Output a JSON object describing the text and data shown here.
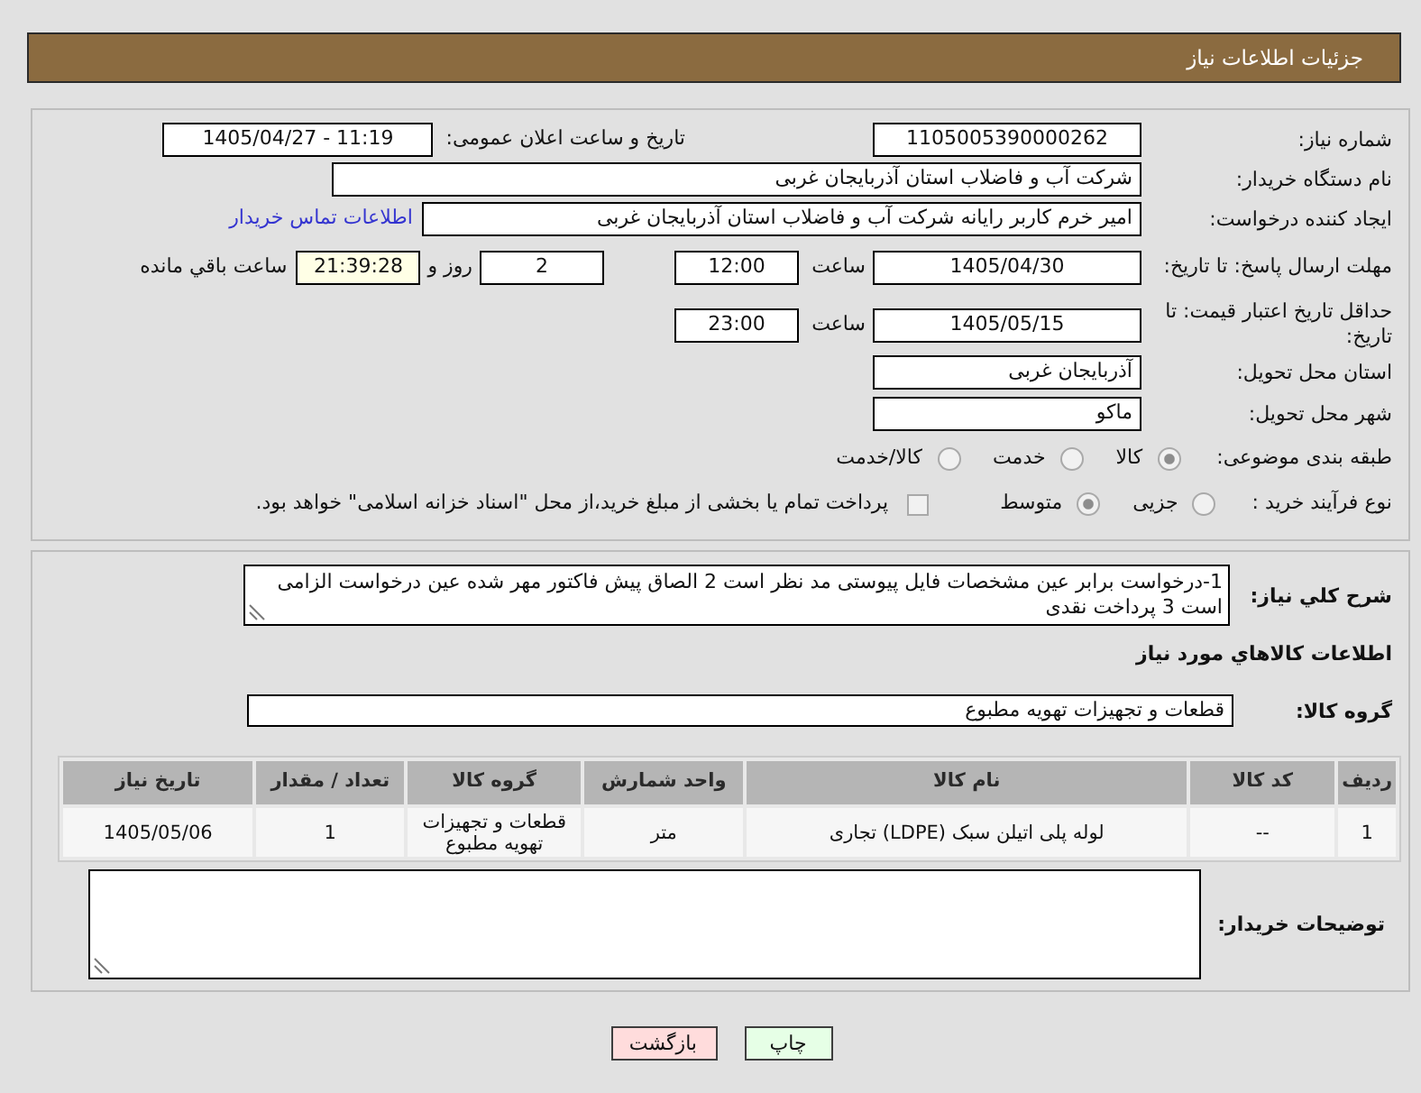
{
  "header": {
    "title": "جزئیات اطلاعات نیاز"
  },
  "need": {
    "number": {
      "label": "شماره نیاز:",
      "value": "1105005390000262"
    },
    "announce": {
      "label": "تاریخ و ساعت اعلان عمومی:",
      "value": "1405/04/27 - 11:19"
    },
    "buyer_org": {
      "label": "نام دستگاه خریدار:",
      "value": "شرکت آب و فاضلاب استان آذربایجان غربی"
    },
    "creator": {
      "label": "ایجاد کننده درخواست:",
      "value": "امیر خرم کاربر رایانه شرکت آب و فاضلاب استان آذربایجان غربی",
      "contact_link": "اطلاعات تماس خریدار"
    },
    "response_deadline": {
      "label": "مهلت ارسال پاسخ: تا تاریخ:",
      "date": "1405/04/30",
      "time_label": "ساعت",
      "time": "12:00",
      "days": "2",
      "days_label": "روز و",
      "remaining": "21:39:28",
      "remaining_label": "ساعت باقي مانده"
    },
    "price_validity": {
      "label": "حداقل تاریخ اعتبار قیمت: تا تاریخ:",
      "date": "1405/05/15",
      "time_label": "ساعت",
      "time": "23:00"
    },
    "province": {
      "label": "استان محل تحویل:",
      "value": "آذربایجان غربی"
    },
    "city": {
      "label": "شهر محل تحویل:",
      "value": "ماکو"
    },
    "category": {
      "label": "طبقه بندی موضوعی:",
      "options": [
        {
          "label": "کالا",
          "selected": true
        },
        {
          "label": "خدمت",
          "selected": false
        },
        {
          "label": "کالا/خدمت",
          "selected": false
        }
      ]
    },
    "purchase_process": {
      "label": "نوع فرآیند خرید :",
      "options": [
        {
          "label": "جزیی",
          "selected": false
        },
        {
          "label": "متوسط",
          "selected": true
        }
      ],
      "treasury": {
        "label": "پرداخت تمام یا بخشی از مبلغ خرید،از محل \"اسناد خزانه اسلامی\" خواهد بود.",
        "checked": false
      }
    }
  },
  "description": {
    "label": "شرح کلي نیاز:",
    "value": "1-درخواست برابر عین مشخصات فایل پیوستی مد نظر است 2 الصاق پیش فاکتور مهر شده عین درخواست الزامی است 3 پرداخت نقدی"
  },
  "goods": {
    "title": "اطلاعات کالاهاي مورد نیاز",
    "group": {
      "label": "گروه کالا:",
      "value": "قطعات و تجهیزات تهویه مطبوع"
    },
    "table": {
      "columns": [
        "ردیف",
        "کد کالا",
        "نام کالا",
        "واحد شمارش",
        "گروه کالا",
        "تعداد / مقدار",
        "تاریخ نیاز"
      ],
      "rows": [
        [
          "1",
          "--",
          "لوله پلی اتیلن سبک (LDPE) تجاری",
          "متر",
          "قطعات و تجهیزات تهویه مطبوع",
          "1",
          "1405/05/06"
        ]
      ]
    }
  },
  "buyer_notes": {
    "label": "توضیحات خریدار:"
  },
  "buttons": [
    {
      "label": "چاپ",
      "kind": "print"
    },
    {
      "label": "بازگشت",
      "kind": "back"
    }
  ]
}
